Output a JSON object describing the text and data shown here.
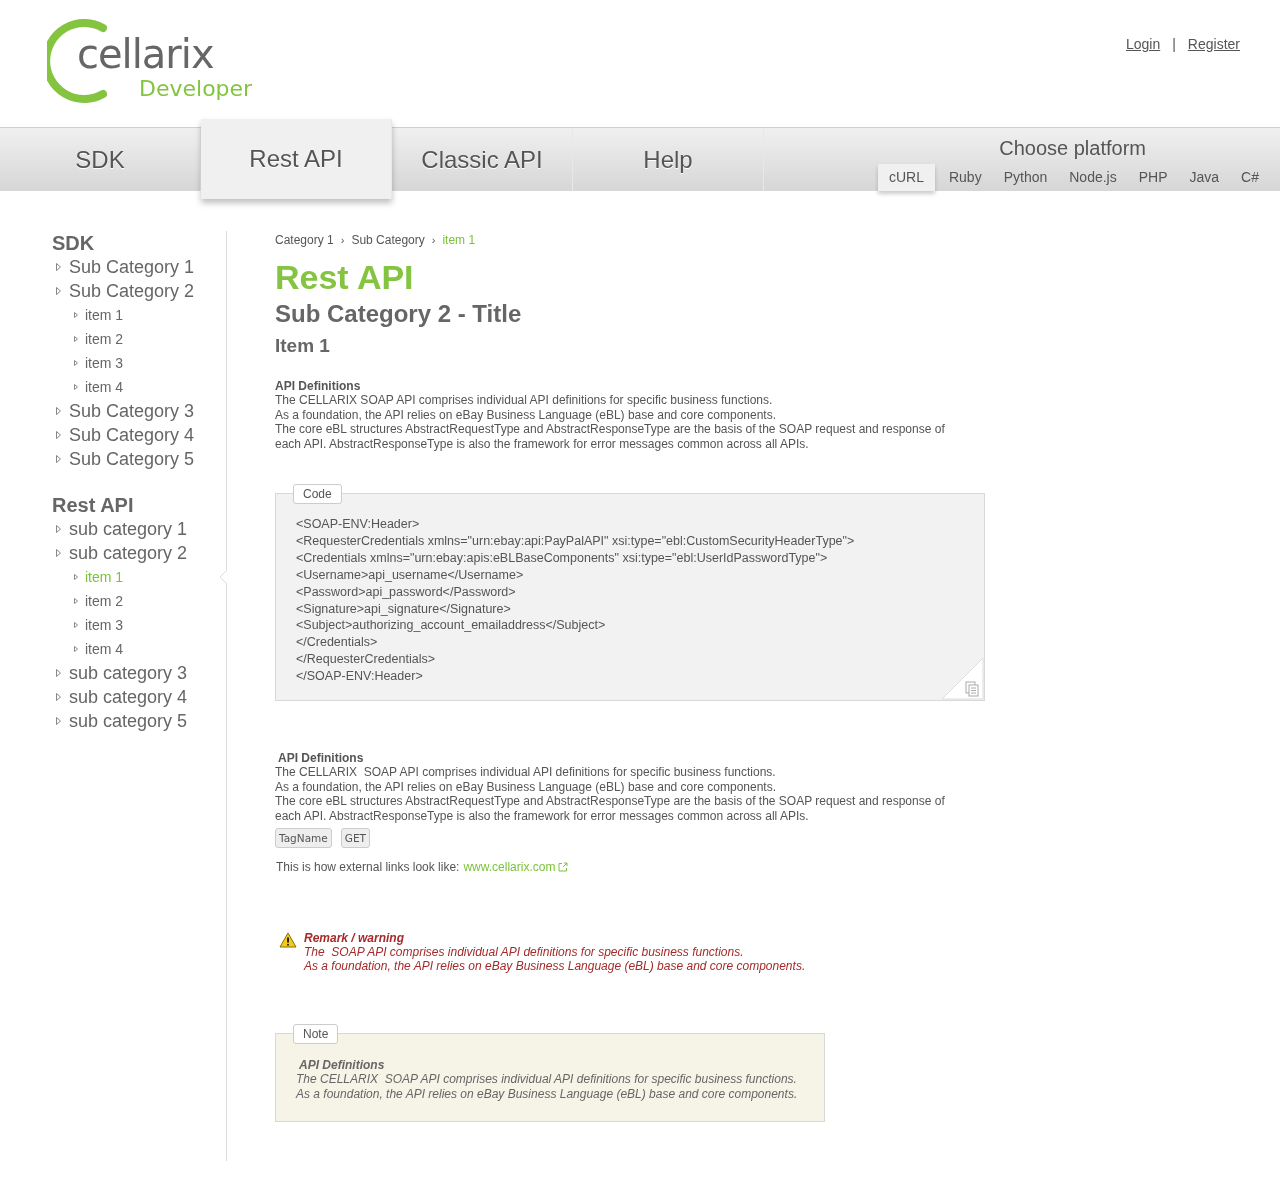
{
  "logo": {
    "name": "cellarix",
    "tagline": "Developer"
  },
  "header_links": [
    {
      "label": "Login"
    },
    {
      "label": "Register"
    }
  ],
  "header_separator": "|",
  "nav": {
    "tabs": [
      {
        "label": "SDK",
        "selected": false
      },
      {
        "label": "Rest API",
        "selected": true
      },
      {
        "label": "Classic API",
        "selected": false
      },
      {
        "label": "Help",
        "selected": false
      }
    ]
  },
  "platform": {
    "title": "Choose platform",
    "options": [
      {
        "label": "cURL",
        "selected": true
      },
      {
        "label": "Ruby",
        "selected": false
      },
      {
        "label": "Python",
        "selected": false
      },
      {
        "label": "Node.js",
        "selected": false
      },
      {
        "label": "PHP",
        "selected": false
      },
      {
        "label": "Java",
        "selected": false
      },
      {
        "label": "C#",
        "selected": false
      }
    ]
  },
  "sidebar": {
    "sections": [
      {
        "title": "SDK",
        "items": [
          {
            "label": "Sub Category 1"
          },
          {
            "label": "Sub Category 2",
            "children": [
              {
                "label": "item 1",
                "selected": false
              },
              {
                "label": "item 2",
                "selected": false
              },
              {
                "label": "item 3",
                "selected": false
              },
              {
                "label": "item 4",
                "selected": false
              }
            ]
          },
          {
            "label": "Sub Category 3"
          },
          {
            "label": "Sub Category 4"
          },
          {
            "label": "Sub Category 5"
          }
        ]
      },
      {
        "title": "Rest API",
        "items": [
          {
            "label": "sub category 1"
          },
          {
            "label": "sub category 2",
            "children": [
              {
                "label": "item 1",
                "selected": true
              },
              {
                "label": "item 2",
                "selected": false
              },
              {
                "label": "item 3",
                "selected": false
              },
              {
                "label": "item 4",
                "selected": false
              }
            ]
          },
          {
            "label": "sub category 3"
          },
          {
            "label": "sub category 4"
          },
          {
            "label": "sub category 5"
          }
        ]
      }
    ]
  },
  "breadcrumb": [
    {
      "label": "Category 1",
      "current": false
    },
    {
      "label": "Sub Category",
      "current": false
    },
    {
      "label": "item 1",
      "current": true
    }
  ],
  "breadcrumb_separator": "›",
  "title": "Rest API",
  "subtitle": "Sub Category 2 - Title",
  "item_title": "Item 1",
  "intro": {
    "heading": "API Definitions",
    "lines": [
      "The CELLARIX SOAP API comprises individual API definitions for specific business functions.",
      "As a foundation, the API relies on eBay Business Language (eBL) base and core components.",
      "The core eBL structures AbstractRequestType and AbstractResponseType are the basis of the SOAP request and response of each API. AbstractResponseType is also the framework for error messages common across all APIs."
    ]
  },
  "code": {
    "label": "Code",
    "lines": [
      "<SOAP-ENV:Header>",
      "<RequesterCredentials xmlns=\"urn:ebay:api:PayPalAPI\" xsi:type=\"ebl:CustomSecurityHeaderType\">",
      "<Credentials xmlns=\"urn:ebay:apis:eBLBaseComponents\" xsi:type=\"ebl:UserIdPasswordType\">",
      "<Username>api_username</Username>",
      "<Password>api_password</Password>",
      "<Signature>api_signature</Signature>",
      "<Subject>authorizing_account_emailaddress</Subject>",
      "</Credentials>",
      "</RequesterCredentials>",
      "</SOAP-ENV:Header>"
    ]
  },
  "definitions": {
    "heading": "API Definitions",
    "lines": [
      "The CELLARIX  SOAP API comprises individual API definitions for specific business functions.",
      "As a foundation, the API relies on eBay Business Language (eBL) base and core components.",
      "The core eBL structures AbstractRequestType and AbstractResponseType are the basis of the SOAP request and response of each API. AbstractResponseType is also the framework for error messages common across all APIs."
    ]
  },
  "tags": [
    "TagName",
    "GET"
  ],
  "external_link": {
    "text": "This is how external links look like:",
    "link": "www.cellarix.com"
  },
  "warning": {
    "title": "Remark / warning",
    "lines": [
      "The  SOAP API comprises individual API definitions for specific business functions.",
      "As a foundation, the API relies on eBay Business Language (eBL) base and core components."
    ]
  },
  "note": {
    "label": "Note",
    "heading": "API Definitions",
    "lines": [
      "The CELLARIX  SOAP API comprises individual API definitions for specific business functions.",
      "As a foundation, the API relies on eBay Business Language (eBL) base and core components."
    ]
  }
}
